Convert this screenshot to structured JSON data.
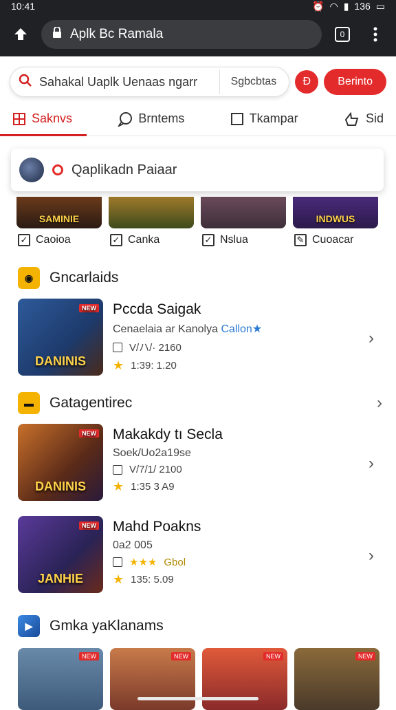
{
  "status": {
    "time": "10:41",
    "battery": "136"
  },
  "browser": {
    "url_text": "Aplk Bc Ramala",
    "tabs_count": "0"
  },
  "search": {
    "placeholder": "Sahakal Uaplk Uenaas ngarr",
    "alt_label": "Sgbcbtas",
    "circle_label": "Ð",
    "button_label": "Berinto"
  },
  "tabs": [
    {
      "label": "Saknvs",
      "icon": "book-icon",
      "active": true
    },
    {
      "label": "Brntems",
      "icon": "chat-icon",
      "active": false
    },
    {
      "label": "Tkampar",
      "icon": "square-icon",
      "active": false
    },
    {
      "label": "Sid",
      "icon": "thumb-icon",
      "active": false
    }
  ],
  "dropdown": {
    "text": "Qaplikadn Paiaar"
  },
  "thumbs": [
    {
      "title": "SAMINIE",
      "color": "#2a1b14"
    },
    {
      "title": "",
      "color": "#3d4a1c"
    },
    {
      "title": "",
      "color": "#3e2f3a"
    },
    {
      "title": "INDWUS",
      "color": "#2b1a4a"
    }
  ],
  "checks": [
    {
      "label": "Caoioa",
      "icon": "check-icon"
    },
    {
      "label": "Canka",
      "icon": "check-icon"
    },
    {
      "label": "Nslua",
      "icon": "check-icon"
    },
    {
      "label": "Cuoacar",
      "icon": "edit-icon"
    }
  ],
  "sections": {
    "first": "Gncarlaids",
    "second": "Gatagentirec",
    "third": "Gmka yaKlanams"
  },
  "apps": [
    {
      "name": "Pccda Saigak",
      "sub": "Cenaelaia ar Kanolya",
      "sub_link": "Callon★",
      "meta": "V/ハ/· 2160",
      "rating": "1:39: 1.20",
      "art_title": "DANINIS",
      "badge": "NEW",
      "art_color": "#1d3a6b"
    },
    {
      "name": "Makakdy tı Secla",
      "sub": "Soek/Uo2a19se",
      "meta": "V/7/1/ 2100",
      "rating": "1:35 3 A9",
      "art_title": "DANINIS",
      "badge": "NEW",
      "art_color": "#5a2a18"
    },
    {
      "name": "Mahd Poakns",
      "sub": "0a2 005",
      "meta_stars": "★★★",
      "meta_text": "Gbol",
      "rating": "135: 5.09",
      "art_title": "JANHIE",
      "badge": "NEW",
      "art_color": "#2a2356"
    }
  ],
  "grid": [
    {
      "badge": "NEW",
      "color": "#3d5a7a"
    },
    {
      "badge": "NEW",
      "color": "#7a3a2a"
    },
    {
      "badge": "NEW",
      "color": "#8a2a2a"
    },
    {
      "badge": "NEW",
      "color": "#4a3a2a"
    }
  ]
}
